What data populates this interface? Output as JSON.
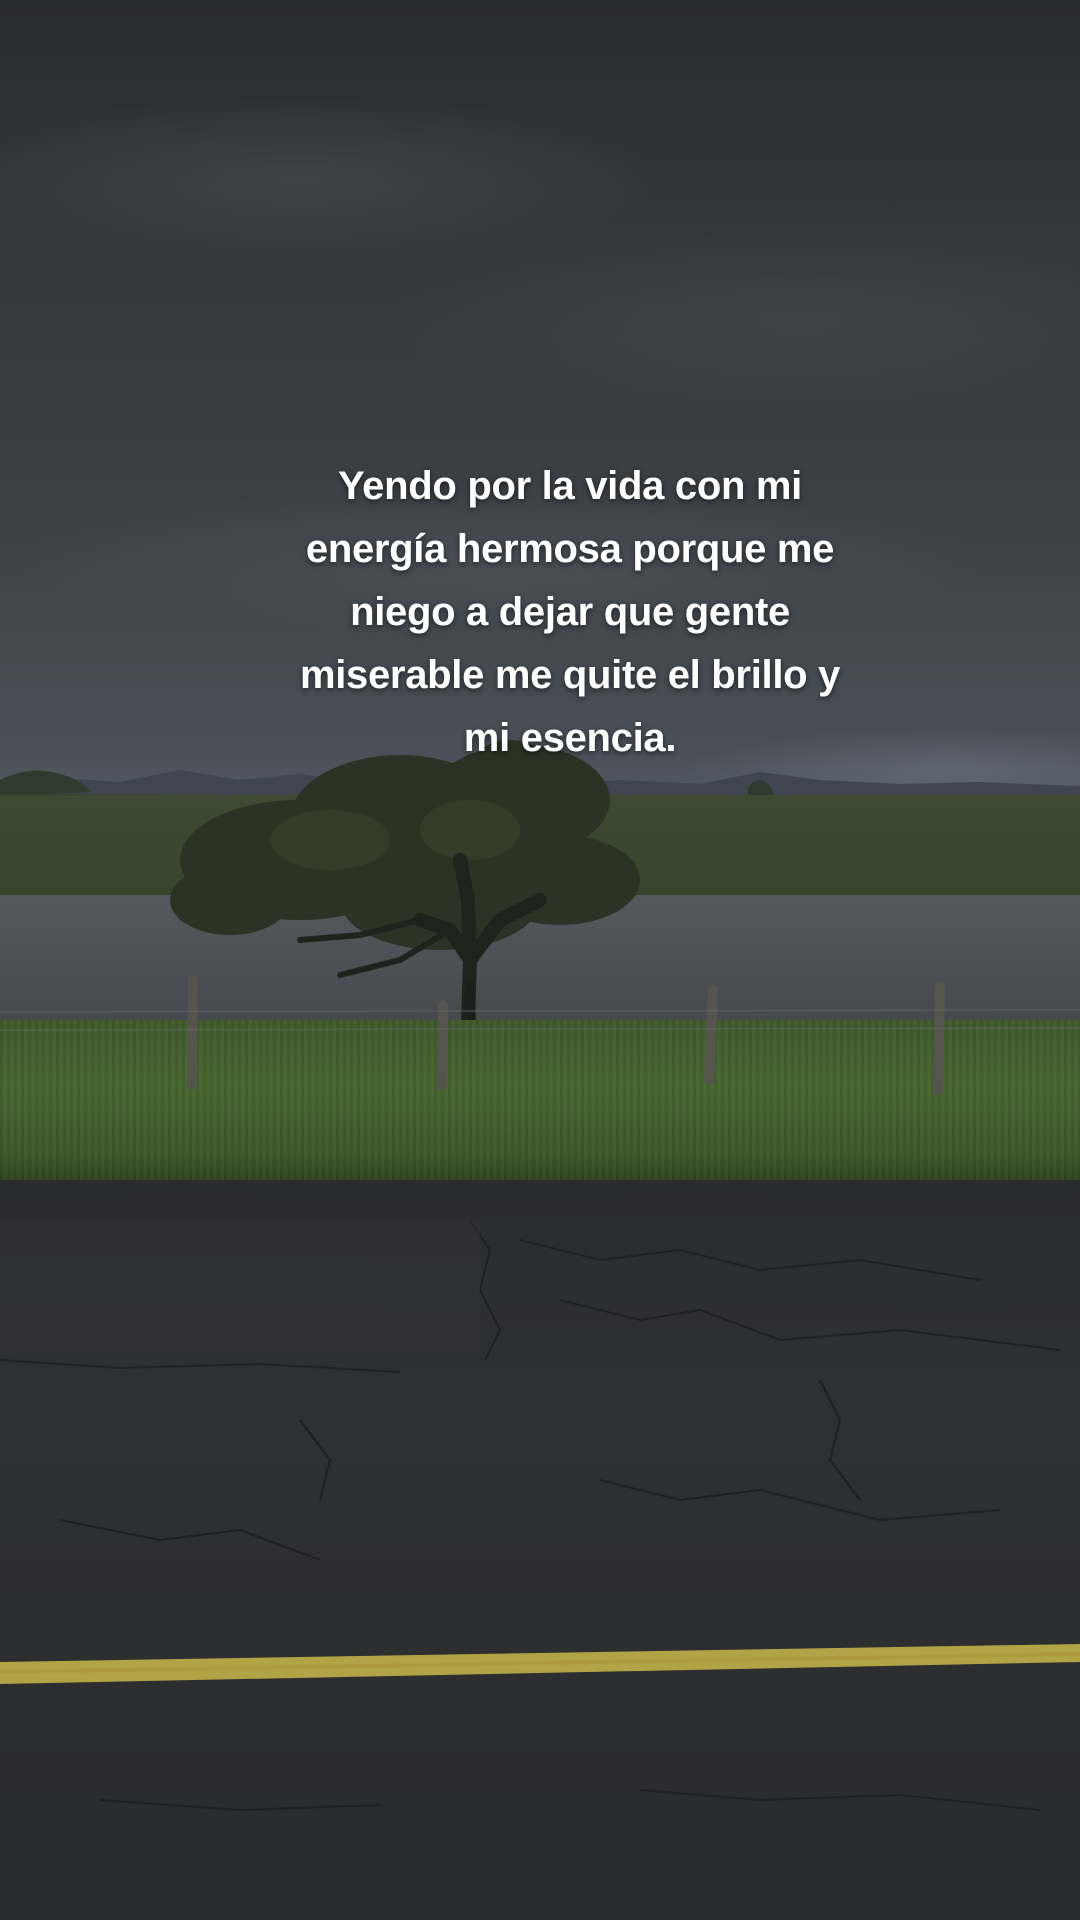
{
  "caption": {
    "lines": [
      "Yendo por la vida con mi",
      "energía hermosa porque me",
      "niego a dejar que gente",
      "miserable me quite el brillo y",
      "mi esencia."
    ]
  },
  "scene": {
    "elements": [
      "cloudy-sky",
      "distant-mountains",
      "green-field",
      "pond",
      "lone-tree",
      "fence-posts",
      "grass-verge",
      "cracked-asphalt-road",
      "yellow-road-line"
    ],
    "colors": {
      "sky": "#36383c",
      "grass": "#46662f",
      "water": "#4d5156",
      "asphalt": "#2d2e30",
      "road_line": "#c9b84a",
      "text": "#ffffff"
    }
  }
}
